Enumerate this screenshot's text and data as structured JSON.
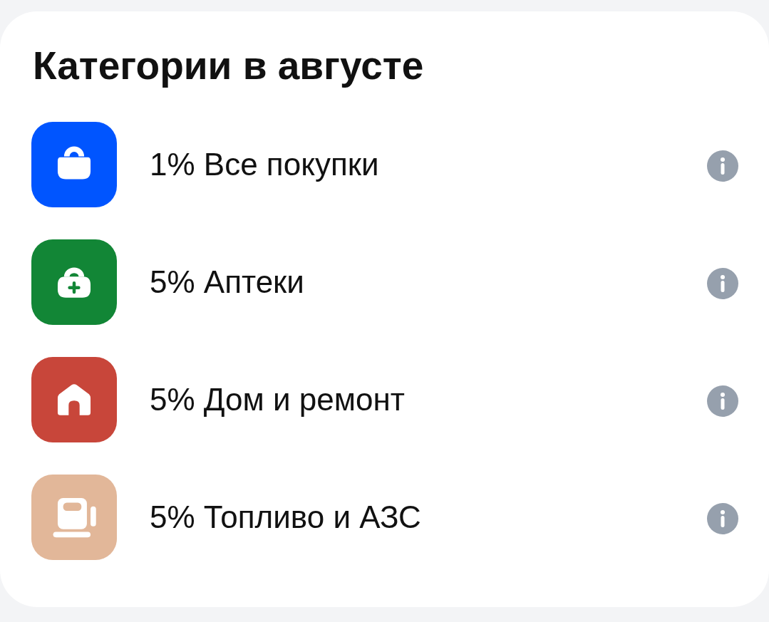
{
  "card": {
    "title": "Категории в августе"
  },
  "categories": [
    {
      "kind": "shopping",
      "label": "1% Все покупки",
      "color": "#0055ff"
    },
    {
      "kind": "pharmacy",
      "label": "5% Аптеки",
      "color": "#128636"
    },
    {
      "kind": "home",
      "label": "5% Дом и ремонт",
      "color": "#c8463a"
    },
    {
      "kind": "fuel",
      "label": "5% Топливо и АЗС",
      "color": "#e2b799"
    }
  ]
}
